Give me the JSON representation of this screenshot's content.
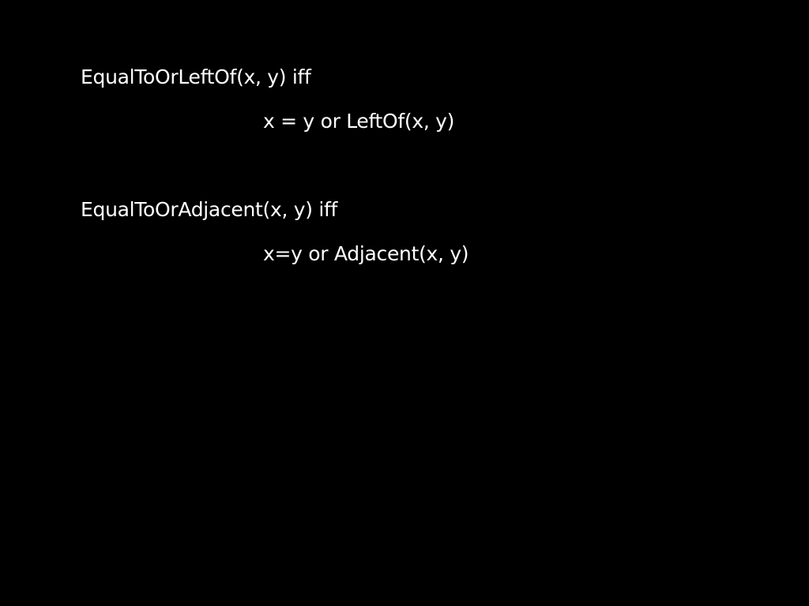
{
  "slide": {
    "definitions": [
      {
        "head": "EqualToOrLeftOf(x, y) iff",
        "body": "x = y or LeftOf(x, y)"
      },
      {
        "head": "EqualToOrAdjacent(x, y) iff",
        "body": "x=y or Adjacent(x, y)"
      }
    ]
  },
  "colors": {
    "background": "#000000",
    "text": "#ffffff"
  }
}
